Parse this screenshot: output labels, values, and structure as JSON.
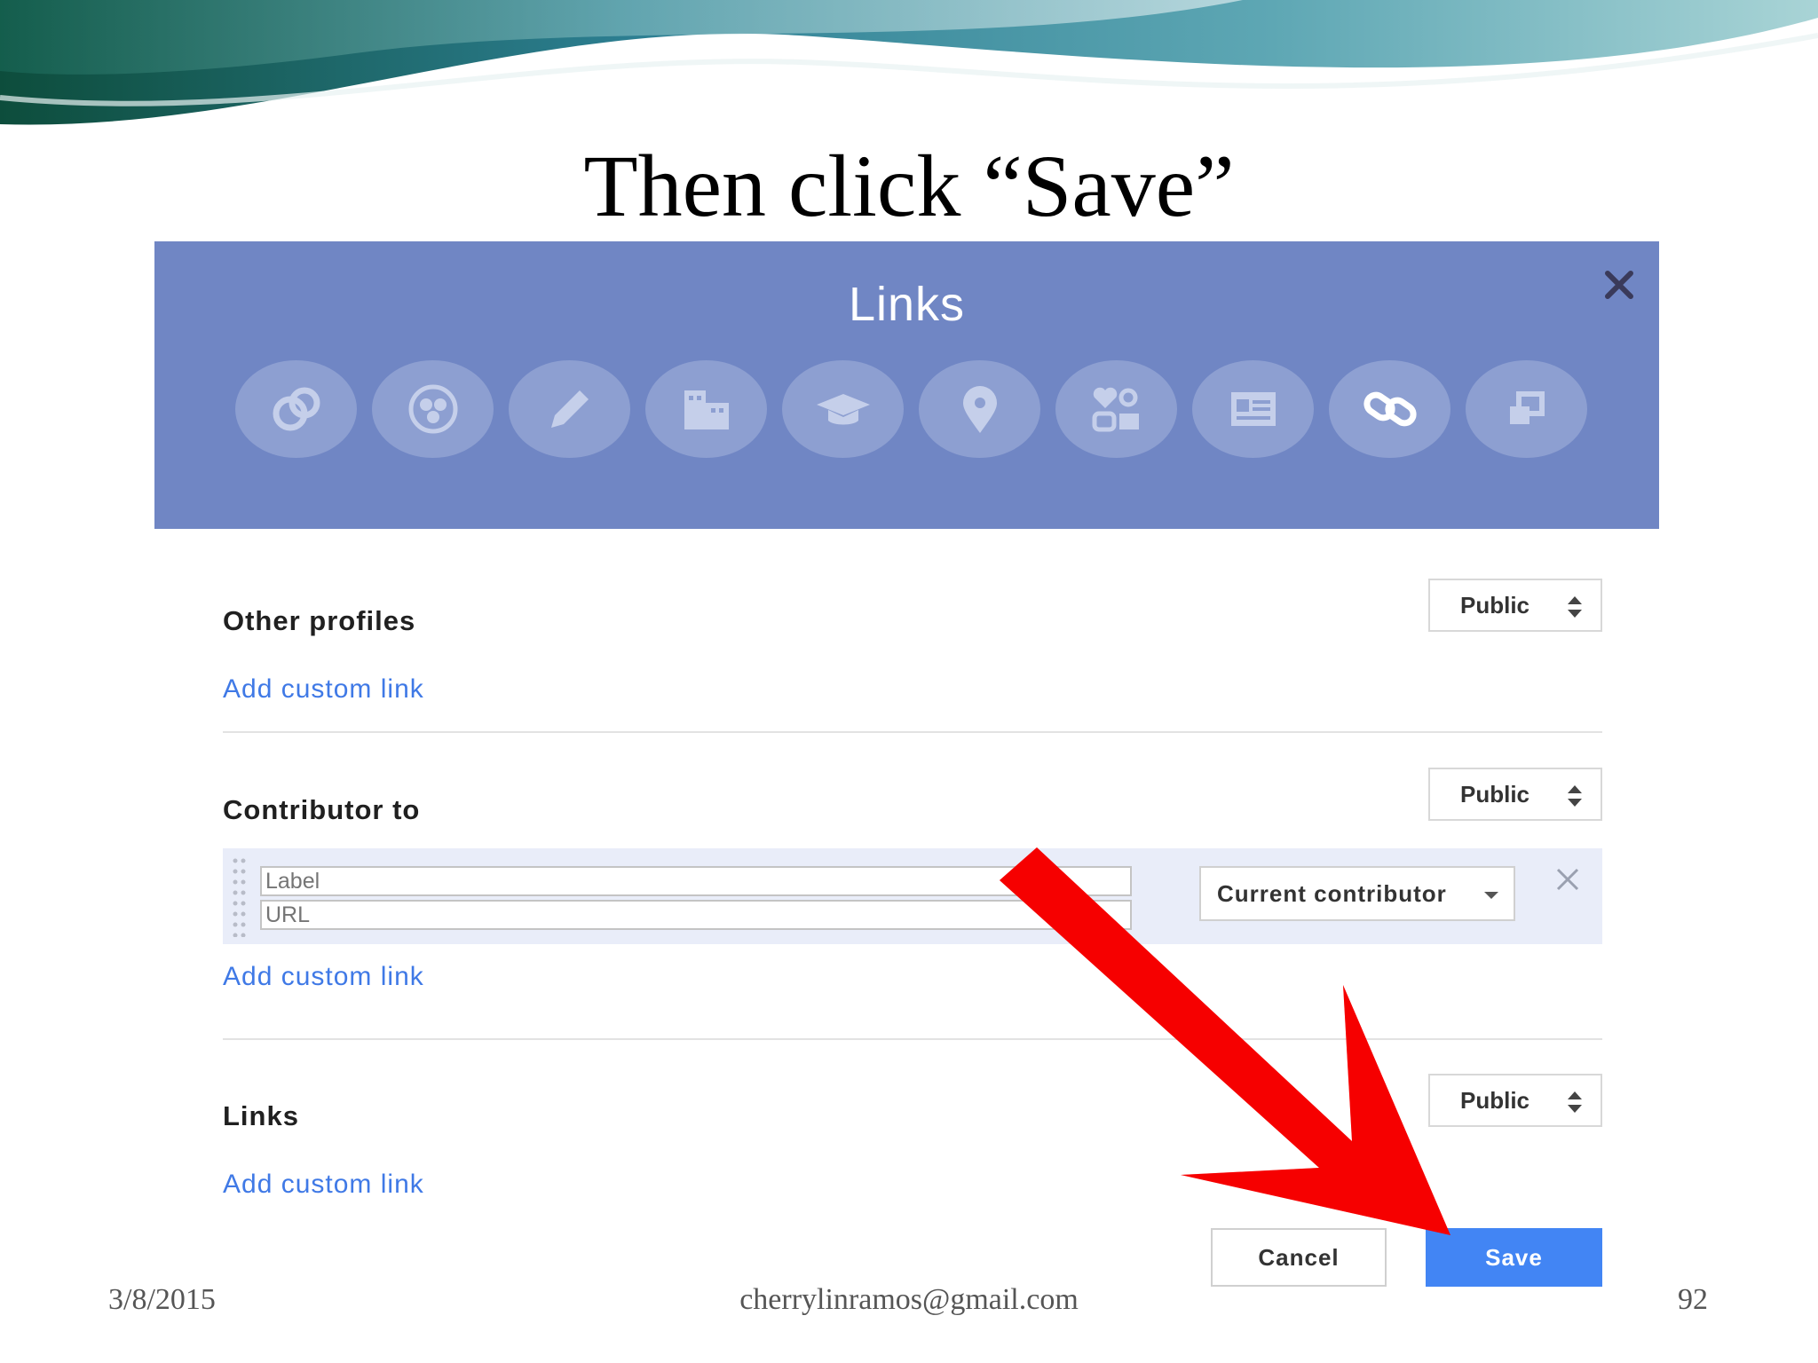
{
  "slide": {
    "title": "Then click “Save”",
    "footer_date": "3/8/2015",
    "footer_email": "cherrylinramos@gmail.com",
    "page_number": "92"
  },
  "dialog": {
    "title": "Links",
    "close_icon": "close-icon",
    "category_icons": [
      "google-plus-circles-icon",
      "circles-icon",
      "pencil-icon",
      "building-icon",
      "graduation-cap-icon",
      "location-pin-icon",
      "gender-icon",
      "contact-card-icon",
      "link-icon",
      "other-profiles-icon"
    ],
    "active_category": "link-icon",
    "header_color": "#7086c4",
    "sections": {
      "other_profiles": {
        "title": "Other profiles",
        "add_link": "Add custom link",
        "privacy": "Public"
      },
      "contributor_to": {
        "title": "Contributor to",
        "add_link": "Add custom link",
        "privacy": "Public",
        "row": {
          "label_placeholder": "Label",
          "url_placeholder": "URL",
          "status": "Current contributor"
        }
      },
      "links": {
        "title": "Links",
        "add_link": "Add custom link",
        "privacy": "Public"
      }
    },
    "buttons": {
      "cancel": "Cancel",
      "save": "Save"
    },
    "save_color": "#4285f4",
    "link_color": "#3f79e6"
  },
  "annotation": {
    "arrow_color": "#ff0000",
    "arrow_target": "Save"
  }
}
